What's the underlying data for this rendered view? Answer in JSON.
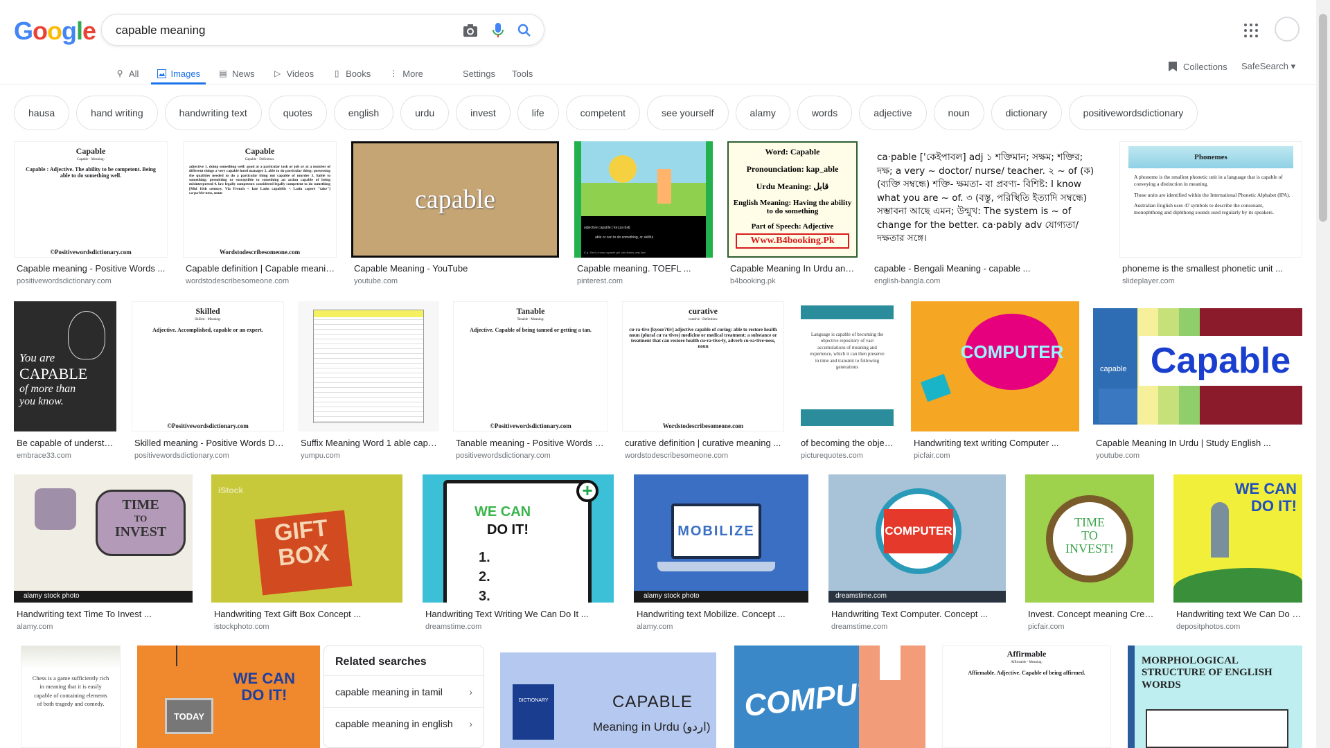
{
  "search": {
    "query": "capable meaning"
  },
  "nav": {
    "tabs": [
      {
        "label": "All"
      },
      {
        "label": "Images"
      },
      {
        "label": "News"
      },
      {
        "label": "Videos"
      },
      {
        "label": "Books"
      },
      {
        "label": "More"
      }
    ],
    "settings": "Settings",
    "tools": "Tools",
    "collections": "Collections",
    "safesearch": "SafeSearch"
  },
  "chips": [
    "hausa",
    "hand writing",
    "handwriting text",
    "quotes",
    "english",
    "urdu",
    "invest",
    "life",
    "competent",
    "see yourself",
    "alamy",
    "words",
    "adjective",
    "noun",
    "dictionary",
    "positivewordsdictionary"
  ],
  "results": {
    "row1": [
      {
        "caption": "Capable meaning - Positive Words ...",
        "source": "positivewordsdictionary.com",
        "title": "Capable",
        "subtitle": "Capable - Meaning:",
        "body": "Capable : Adjective. The ability to be competent. Being able to do something well.",
        "footer": "©Positivewordsdictionary.com"
      },
      {
        "caption": "Capable definition | Capable meanin...",
        "source": "wordstodescribesomeone.com",
        "title": "Capable",
        "subtitle": "Capable - Definition:",
        "body": "adjective 1. doing something well: good at a particular task or job or at a number of different things a very capable hotel manager 2. able to do particular thing: possessing the qualities needed to do a particular thing not capable of murder 3. liable to something: permitting or susceptible to something an action capable of being misinterpreted 4. law legally competent: considered legally competent to do something [Mid 16th century. Via French < late Latin capabilis < Latin capere \"take\"] ca·pa·ble·ness, noun",
        "footer": "Wordstodescribesomeone.com"
      },
      {
        "caption": "Capable Meaning - YouTube",
        "source": "youtube.com",
        "word": "capable"
      },
      {
        "caption": "Capable meaning. TOEFL ...",
        "source": "pinterest.com",
        "line1": "adjective   capable  [ˈkeɪ.pə.bəl]",
        "line2": "able or can to do something, or skillful",
        "line3": "E.g. She's a very capable girl, she learns very fast."
      },
      {
        "caption": "Capable Meaning In Urdu and...",
        "source": "b4booking.pk",
        "l1": "Word: Capable",
        "l2": "Pronounciation: kap_able",
        "l3": "Urdu Meaning: قابل",
        "l4": "English Meaning:  Having the ability to do something",
        "l5": "Part of Speech:  Adjective",
        "l6": "Www.B4booking.Pk"
      },
      {
        "caption": "capable - Bengali Meaning - capable ...",
        "source": "english-bangla.com",
        "text": "ca·pable ['কেইপাবল] adj ১ শক্তিমান; সক্ষম; শক্তির; দক্ষ; a very ~ doctor/ nurse/ teacher. ২ ~ of (ক) (ব্যক্তি সম্বন্ধে) শক্তি- ক্ষমতা- বা প্রবণ্য- বিশিষ্ট: I know what you are ~ of. ৩ (বস্তু, পরিস্থিতি ইত্যাদি সম্বন্ধে) সম্ভাবনা আছে এমন; উন্মুখ: The system is ~ of change for the better. ca·pably adv যোগ্যতা/ দক্ষতার সঙ্গে।"
      },
      {
        "caption": "phoneme is the smallest phonetic unit ...",
        "source": "slideplayer.com",
        "title": "Phonemes",
        "b1": "A phoneme is the smallest phonetic unit in a language that is capable of conveying a distinction in meaning.",
        "b2": "These units are identified within the International Phonetic Alphabet (IPA).",
        "b3": "Australian English uses 47 symbols to describe the consonant, monophthong and diphthong sounds used regularly by its speakers."
      }
    ],
    "row2": [
      {
        "caption": "Be capable of understa...",
        "source": "embrace33.com",
        "text1": "You are",
        "text2": "CAPABLE",
        "text3": "of more than",
        "text4": "you know."
      },
      {
        "caption": "Skilled meaning - Positive Words Di...",
        "source": "positivewordsdictionary.com",
        "title": "Skilled",
        "subtitle": "Skilled - Meaning:",
        "body": "Adjective. Accomplished, capable or an expert.",
        "footer": "©Positivewordsdictionary.com"
      },
      {
        "caption": "Suffix Meaning Word 1 able capa...",
        "source": "yumpu.com"
      },
      {
        "caption": "Tanable meaning - Positive Words Di...",
        "source": "positivewordsdictionary.com",
        "title": "Tanable",
        "subtitle": "Tanable - Meaning:",
        "body": "Adjective. Capable of being tanned or getting a tan.",
        "footer": "©Positivewordsdictionary.com"
      },
      {
        "caption": "curative definition | curative meaning ...",
        "source": "wordstodescribesomeone.com",
        "title": "curative",
        "subtitle": "curative - Definition:",
        "body": "cu·ra·tive [kyoor?tiv] adjective capable of curing: able to restore health noun (plural cu·ra·tives) medicine or medical treatment: a substance or treatment that can restore health cu·ra·tive·ly, adverb cu·ra·tive·ness, noun",
        "footer": "Wordstodescribesomeone.com"
      },
      {
        "caption": "of becoming the object...",
        "source": "picturequotes.com",
        "body": "Language is capable of becoming the objective repository of vast accumulations of meaning and experience, which it can then preserve in time and transmit to following generations"
      },
      {
        "caption": "Handwriting text writing Computer ...",
        "source": "picfair.com",
        "word": "COMPUTER"
      },
      {
        "caption": "Capable Meaning In Urdu | Study English ...",
        "source": "youtube.com",
        "word": "Capable",
        "small": "capable"
      }
    ],
    "row3": [
      {
        "caption": "Handwriting text Time To Invest ...",
        "source": "alamy.com",
        "l1": "TIME",
        "l2": "TO",
        "l3": "INVEST",
        "badge": "alamy stock photo"
      },
      {
        "caption": "Handwriting Text Gift Box Concept ...",
        "source": "istockphoto.com",
        "l1": "GIFT",
        "l2": "BOX",
        "wm": "iStock"
      },
      {
        "caption": "Handwriting Text Writing We Can Do It ...",
        "source": "dreamstime.com",
        "l1": "WE  CAN",
        "l2": "DO   IT!",
        "n1": "1.",
        "n2": "2.",
        "n3": "3."
      },
      {
        "caption": "Handwriting text Mobilize. Concept ...",
        "source": "alamy.com",
        "word": "MOBILIZE",
        "badge": "alamy stock photo"
      },
      {
        "caption": "Handwriting Text Computer. Concept ...",
        "source": "dreamstime.com",
        "word": "COMPUTER",
        "badge": "dreamstime.com"
      },
      {
        "caption": "Invest. Concept meaning Creat...",
        "source": "picfair.com",
        "l1": "TIME",
        "l2": "TO",
        "l3": "INVEST!"
      },
      {
        "caption": "Handwriting text We Can Do It...",
        "source": "depositphotos.com",
        "l1": "WE CAN",
        "l2": "DO IT!"
      }
    ],
    "row4": [
      {
        "body": "Chess is a game sufficiently rich in meaning that it is easily capable of containing elements of both tragedy and comedy."
      },
      {
        "l1": "WE CAN",
        "l2": "DO IT!",
        "today": "TODAY"
      },
      {
        "word": "CAPABLE",
        "sub": "Meaning in Urdu (اردو)",
        "book": "DICTIONARY"
      },
      {
        "word": "COMPUTER"
      },
      {
        "title": "Affirmable",
        "subtitle": "Affirmable - Meaning:",
        "body": "Affirmable. Adjective. Capable of being affirmed."
      },
      {
        "title": "MORPHOLOGICAL STRUCTURE OF ENGLISH WORDS"
      }
    ]
  },
  "related": {
    "title": "Related searches",
    "items": [
      {
        "label": "capable meaning in tamil"
      },
      {
        "label": "capable meaning in english"
      }
    ]
  }
}
